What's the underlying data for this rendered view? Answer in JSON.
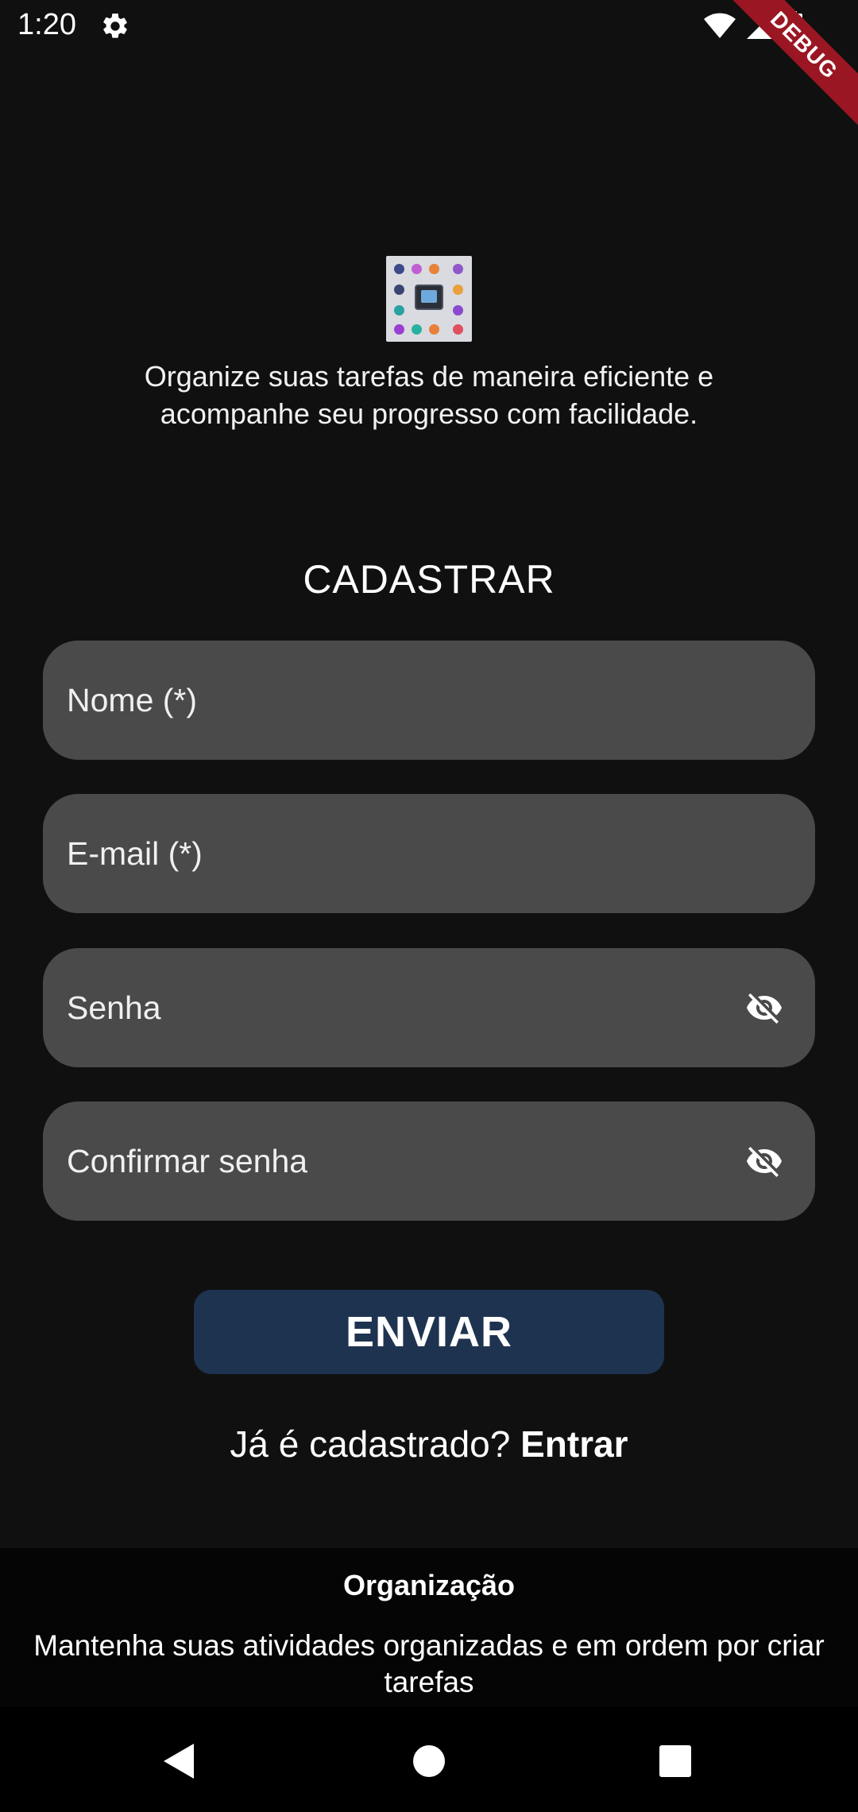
{
  "status_bar": {
    "time": "1:20",
    "debug_label": "DEBUG"
  },
  "header": {
    "tagline_line1": "Organize suas tarefas de maneira eficiente e",
    "tagline_line2": "acompanhe seu progresso com facilidade."
  },
  "form": {
    "title": "CADASTRAR",
    "name_placeholder": "Nome (*)",
    "email_placeholder": "E-mail (*)",
    "password_placeholder": "Senha",
    "confirm_password_placeholder": "Confirmar senha",
    "submit_label": "ENVIAR"
  },
  "login_prompt": {
    "question": "Já é cadastrado? ",
    "link_label": "Entrar"
  },
  "info_panel": {
    "title": "Organização",
    "text_line1": "Mantenha suas atividades organizadas e em ordem por criar",
    "text_line2": "tarefas"
  },
  "colors": {
    "background": "#101010",
    "field": "#4a4a4a",
    "button": "#1e3350",
    "debug_banner": "#9a1622"
  }
}
